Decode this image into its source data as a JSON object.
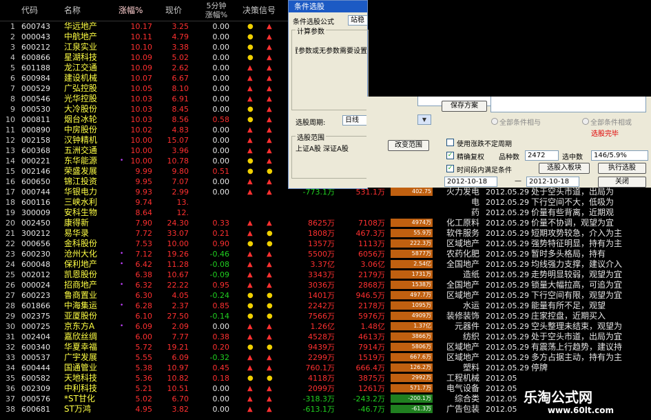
{
  "header": {
    "col_code": "代码",
    "col_name": "名称",
    "col_chg": "涨幅%",
    "col_price": "现价",
    "col_5min_1": "5分钟",
    "col_5min_2": "涨幅%",
    "col_signal": "决策信号"
  },
  "rows": [
    {
      "n": "1",
      "code": "600743",
      "name": "华远地产",
      "chg": "10.17",
      "price": "3.25",
      "m5": "0.00",
      "s1": "circle",
      "s2": "up"
    },
    {
      "n": "2",
      "code": "000043",
      "name": "中航地产",
      "chg": "10.11",
      "price": "4.79",
      "m5": "0.00",
      "s1": "circle",
      "s2": "up"
    },
    {
      "n": "3",
      "code": "600212",
      "name": "江泉实业",
      "chg": "10.10",
      "price": "3.38",
      "m5": "0.00",
      "s1": "circle",
      "s2": "up"
    },
    {
      "n": "4",
      "code": "600866",
      "name": "星湖科技",
      "chg": "10.09",
      "price": "5.02",
      "m5": "0.00",
      "s1": "circle",
      "s2": "up"
    },
    {
      "n": "5",
      "code": "601188",
      "name": "龙江交通",
      "chg": "10.09",
      "price": "2.62",
      "m5": "0.00",
      "s1": "up",
      "s2": "up"
    },
    {
      "n": "6",
      "code": "600984",
      "name": "建设机械",
      "chg": "10.07",
      "price": "6.67",
      "m5": "0.00",
      "s1": "up",
      "s2": "up"
    },
    {
      "n": "7",
      "code": "000529",
      "name": "广弘控股",
      "chg": "10.05",
      "price": "8.10",
      "m5": "0.00",
      "s1": "up",
      "s2": "up"
    },
    {
      "n": "8",
      "code": "000546",
      "name": "光华控股",
      "chg": "10.03",
      "price": "6.91",
      "m5": "0.00",
      "s1": "up",
      "s2": "up"
    },
    {
      "n": "9",
      "code": "000530",
      "name": "大冷股份",
      "chg": "10.03",
      "price": "8.45",
      "m5": "0.00",
      "s1": "circle",
      "s2": "up"
    },
    {
      "n": "10",
      "code": "000811",
      "name": "烟台冰轮",
      "chg": "10.03",
      "price": "8.56",
      "m5": "0.58",
      "s1": "circle",
      "s2": "up"
    },
    {
      "n": "11",
      "code": "000890",
      "name": "中房股份",
      "chg": "10.02",
      "price": "4.83",
      "m5": "0.00",
      "s1": "up",
      "s2": "up"
    },
    {
      "n": "12",
      "code": "002158",
      "name": "汉钟精机",
      "chg": "10.00",
      "price": "15.07",
      "m5": "0.00",
      "s1": "up",
      "s2": "up"
    },
    {
      "n": "13",
      "code": "600368",
      "name": "五洲交通",
      "chg": "10.00",
      "price": "3.96",
      "m5": "0.00",
      "s1": "up",
      "s2": "up"
    },
    {
      "n": "14",
      "code": "000221",
      "name": "东华能源",
      "mark": "•",
      "chg": "10.00",
      "price": "10.78",
      "m5": "0.00",
      "s1": "circle",
      "s2": "up"
    },
    {
      "n": "15",
      "code": "002146",
      "name": "荣盛发展",
      "chg": "9.99",
      "price": "9.80",
      "m5": "0.51",
      "s1": "circle",
      "s2": "circle"
    },
    {
      "n": "16",
      "code": "600650",
      "name": "锦江投资",
      "chg": "9.95",
      "price": "7.07",
      "m5": "0.00",
      "s1": "up",
      "s2": "up"
    },
    {
      "n": "17",
      "code": "000744",
      "name": "华银电力",
      "chg": "9.93",
      "price": "2.99",
      "m5": "0.00",
      "s1": "up",
      "s2": "up",
      "a1": "-773.1万",
      "a2": "531.1万",
      "bar": "402.75",
      "ind": "火力发电",
      "date": "2012.05.29",
      "comm": "处于空头市道，出局为"
    },
    {
      "n": "18",
      "code": "600116",
      "name": "三峡水利",
      "chg": "9.74",
      "price": "13.",
      "m5": "",
      "s1": "",
      "s2": "",
      "ind": "电",
      "date": "2012.05.29",
      "comm": "下行空间不大，低吸为"
    },
    {
      "n": "19",
      "code": "300009",
      "name": "安科生物",
      "chg": "8.64",
      "price": "12.",
      "m5": "",
      "s1": "",
      "s2": "",
      "ind": "药",
      "date": "2012.05.29",
      "comm": "价量有些背离，近期观"
    },
    {
      "n": "20",
      "code": "002450",
      "name": "康得新",
      "chg": "7.90",
      "price": "24.30",
      "m5": "0.33",
      "s1": "up",
      "s2": "up",
      "a1": "8625万",
      "a2": "7108万",
      "bar": "4974万",
      "ind": "化工原料",
      "date": "2012.05.29",
      "comm": "价量不协调，观望为宜"
    },
    {
      "n": "21",
      "code": "300212",
      "name": "易华录",
      "chg": "7.72",
      "price": "33.07",
      "m5": "0.21",
      "s1": "up",
      "s2": "circle",
      "a1": "1808万",
      "a2": "467.3万",
      "bar": "55.9万",
      "ind": "软件服务",
      "date": "2012.05.29",
      "comm": "短期攻势较急，介入为主"
    },
    {
      "n": "22",
      "code": "000656",
      "name": "金科股份",
      "chg": "7.53",
      "price": "10.00",
      "m5": "0.90",
      "s1": "circle",
      "s2": "circle",
      "a1": "1357万",
      "a2": "1113万",
      "bar": "222.3万",
      "ind": "区域地产",
      "date": "2012.05.29",
      "comm": "强势特征明显，持有为主"
    },
    {
      "n": "23",
      "code": "600230",
      "name": "沧州大化",
      "mark": "•",
      "chg": "7.12",
      "price": "19.26",
      "m5": "-0.46",
      "s1": "up",
      "s2": "up",
      "a1": "5500万",
      "a2": "6056万",
      "bar": "5877万",
      "ind": "农药化肥",
      "date": "2012.05.29",
      "comm": "暂时多头格局，持有"
    },
    {
      "n": "24",
      "code": "600048",
      "name": "保利地产",
      "mark": "•",
      "chg": "6.42",
      "price": "11.28",
      "m5": "-0.08",
      "s1": "up",
      "s2": "up",
      "a1": "3.37亿",
      "a2": "3.06亿",
      "bar": "2.54亿",
      "ind": "全国地产",
      "date": "2012.05.29",
      "comm": "均线强力支撑，建议介入"
    },
    {
      "n": "25",
      "code": "002012",
      "name": "凯恩股份",
      "chg": "6.38",
      "price": "10.67",
      "m5": "-0.09",
      "s1": "up",
      "s2": "up",
      "a1": "3343万",
      "a2": "2179万",
      "bar": "1731万",
      "ind": "造纸",
      "date": "2012.05.29",
      "comm": "走势明显较弱，观望为宜"
    },
    {
      "n": "26",
      "code": "000024",
      "name": "招商地产",
      "mark": "•",
      "chg": "6.32",
      "price": "22.22",
      "m5": "0.95",
      "s1": "up",
      "s2": "up",
      "a1": "3036万",
      "a2": "2868万",
      "bar": "1538万",
      "ind": "全国地产",
      "date": "2012.05.29",
      "comm": "锁量大幅拉高，可追为宜"
    },
    {
      "n": "27",
      "code": "600223",
      "name": "鲁商置业",
      "chg": "6.30",
      "price": "4.05",
      "m5": "-0.24",
      "s1": "circle",
      "s2": "circle",
      "a1": "1401万",
      "a2": "946.5万",
      "bar": "497.7万",
      "ind": "区域地产",
      "date": "2012.05.29",
      "comm": "下行空间有限，观望为宜"
    },
    {
      "n": "28",
      "code": "601866",
      "name": "中海集运",
      "mark": "•",
      "chg": "6.28",
      "price": "2.37",
      "m5": "0.85",
      "s1": "circle",
      "s2": "circle",
      "a1": "2242万",
      "a2": "2178万",
      "bar": "1095万",
      "ind": "水运",
      "date": "2012.05.29",
      "comm": "能量有所不足，观望"
    },
    {
      "n": "29",
      "code": "002375",
      "name": "亚厦股份",
      "chg": "6.10",
      "price": "27.50",
      "m5": "-0.14",
      "s1": "circle",
      "s2": "circle",
      "a1": "7566万",
      "a2": "5976万",
      "bar": "4909万",
      "ind": "装修装饰",
      "date": "2012.05.29",
      "comm": "庄家控盘，近期买入"
    },
    {
      "n": "30",
      "code": "000725",
      "name": "京东方A",
      "mark": "•",
      "chg": "6.09",
      "price": "2.09",
      "m5": "0.00",
      "s1": "up",
      "s2": "up",
      "a1": "1.26亿",
      "a2": "1.48亿",
      "bar": "1.37亿",
      "ind": "元器件",
      "date": "2012.05.29",
      "comm": "空头整理未结束，观望为"
    },
    {
      "n": "31",
      "code": "002404",
      "name": "嘉欣丝绸",
      "chg": "6.00",
      "price": "7.77",
      "m5": "0.38",
      "s1": "up",
      "s2": "up",
      "a1": "4528万",
      "a2": "4613万",
      "bar": "3866万",
      "ind": "纺织",
      "date": "2012.05.29",
      "comm": "处于空头市道，出局为宜"
    },
    {
      "n": "32",
      "code": "600340",
      "name": "华夏幸福",
      "chg": "5.72",
      "price": "19.21",
      "m5": "0.20",
      "s1": "circle",
      "s2": "circle",
      "a1": "9439万",
      "a2": "7914万",
      "bar": "5806万",
      "ind": "区域地产",
      "date": "2012.05.29",
      "comm": "有震荡上行趋势，建议持"
    },
    {
      "n": "33",
      "code": "000537",
      "name": "广宇发展",
      "chg": "5.55",
      "price": "6.09",
      "m5": "-0.32",
      "s1": "up",
      "s2": "up",
      "a1": "2299万",
      "a2": "1519万",
      "bar": "667.6万",
      "ind": "区域地产",
      "date": "2012.05.29",
      "comm": "多方占据主动，持有为主"
    },
    {
      "n": "34",
      "code": "600444",
      "name": "国通管业",
      "chg": "5.38",
      "price": "10.97",
      "m5": "0.45",
      "s1": "up",
      "s2": "up",
      "a1": "760.1万",
      "a2": "666.4万",
      "bar": "126.2万",
      "ind": "塑料",
      "date": "2012.05.29",
      "comm": "停牌"
    },
    {
      "n": "35",
      "code": "600582",
      "name": "天地科技",
      "chg": "5.36",
      "price": "10.82",
      "m5": "0.18",
      "s1": "circle",
      "s2": "circle",
      "a1": "4118万",
      "a2": "3875万",
      "bar": "2992万",
      "ind": "工程机械",
      "date": "2012.05",
      "comm": ""
    },
    {
      "n": "36",
      "code": "002309",
      "name": "中利科技",
      "chg": "5.21",
      "price": "10.51",
      "m5": "0.00",
      "s1": "up",
      "s2": "up",
      "a1": "2099万",
      "a2": "1261万",
      "bar": "571.7万",
      "ind": "电气设备",
      "date": "2012.05",
      "comm": ""
    },
    {
      "n": "37",
      "code": "000576",
      "name": "*ST甘化",
      "chg": "5.02",
      "price": "6.70",
      "m5": "0.00",
      "s1": "up",
      "s2": "up",
      "a1": "-318.3万",
      "a2": "-243.2万",
      "bar": "-200.1万",
      "ind": "综合类",
      "date": "2012.05",
      "comm": ""
    },
    {
      "n": "38",
      "code": "600681",
      "name": "ST万鸿",
      "chg": "4.95",
      "price": "3.82",
      "m5": "0.00",
      "s1": "up",
      "s2": "up",
      "a1": "-613.1万",
      "a2": "-46.7万",
      "bar": "-61.3万",
      "ind": "广告包装",
      "date": "2012.05",
      "comm": ""
    }
  ],
  "dialog": {
    "title": "条件选股",
    "formula_label": "条件选股公式",
    "formula_value": "站稳",
    "params_group": "计算参数",
    "params_text": "本公式不需要设置参数或无参数需要设置",
    "save_button": "保存方案",
    "radio_and": "全部条件相与",
    "radio_or": "全部条件相或",
    "status": "选股完毕",
    "period_label": "选股周期:",
    "period_value": "日线",
    "range_group": "选股范围",
    "range_text": "上证A股 深证A股",
    "change_range_button": "改变范围",
    "use_irregular": "使用涨跌不定周期",
    "adjust_label": "精确复权",
    "stock_count_label": "品种数",
    "stock_count": "2472",
    "selected_label": "选中数",
    "selected_value": "146/5.9%",
    "time_range_label": "时间段内满足条件",
    "to_block_button": "选股入板块",
    "run_button": "执行选股",
    "date_from": "2012-10-18",
    "date_to": "2012-10-18",
    "close_button": "关闭"
  },
  "watermark": {
    "line1": "乐淘公式网",
    "line2": "www.60lt.com"
  },
  "colors": {
    "up": "#ff3030",
    "down": "#20d020",
    "name": "#ffff44",
    "signal_circle": "#f0d000",
    "dialog_bg": "#ece9d8"
  }
}
